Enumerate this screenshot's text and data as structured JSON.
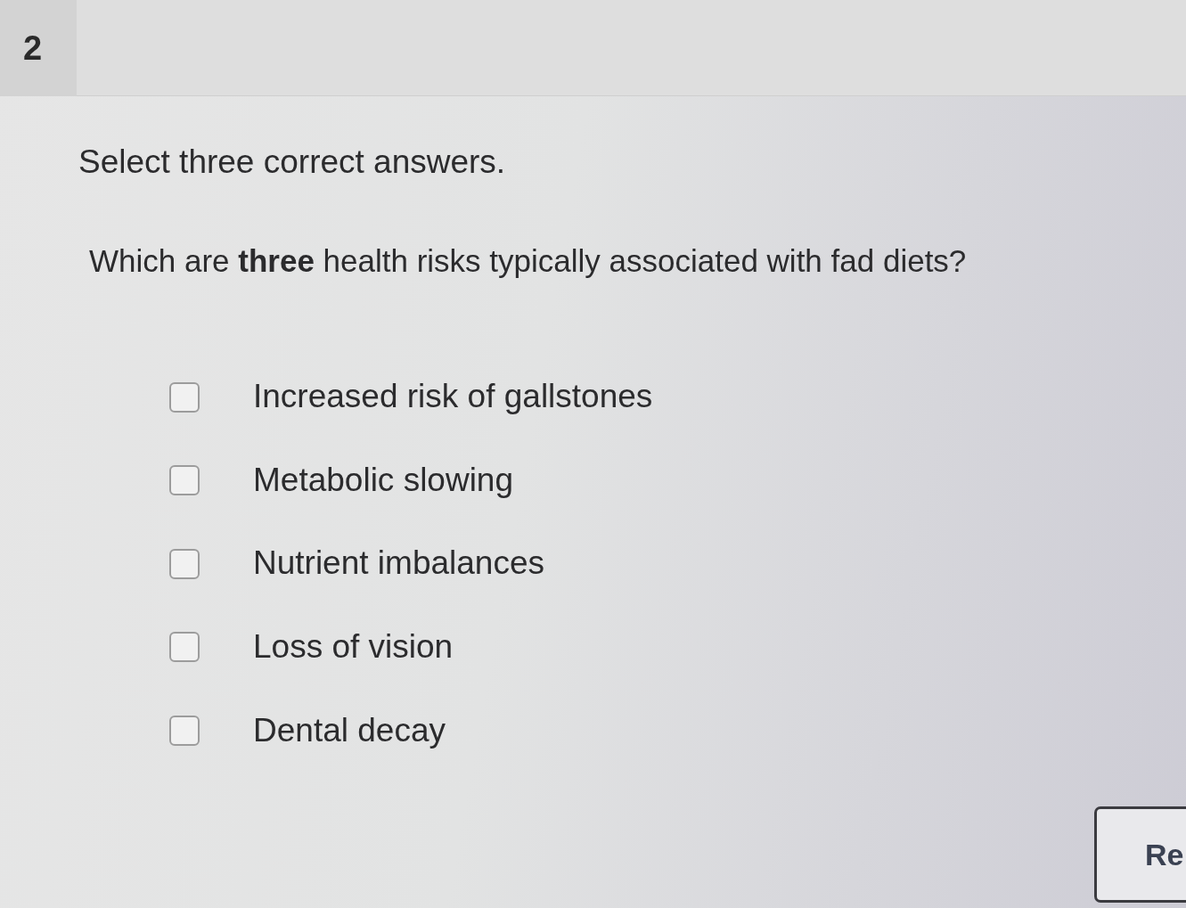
{
  "question_number": "2",
  "instruction": "Select three correct answers.",
  "question": "Which are **three** health risks typically associated with fad diets?",
  "options": [
    {
      "label": "Increased risk of gallstones",
      "checked": false
    },
    {
      "label": "Metabolic slowing",
      "checked": false
    },
    {
      "label": "Nutrient imbalances",
      "checked": false
    },
    {
      "label": "Loss of vision",
      "checked": false
    },
    {
      "label": "Dental decay",
      "checked": false
    }
  ],
  "button": {
    "label": "Re"
  }
}
